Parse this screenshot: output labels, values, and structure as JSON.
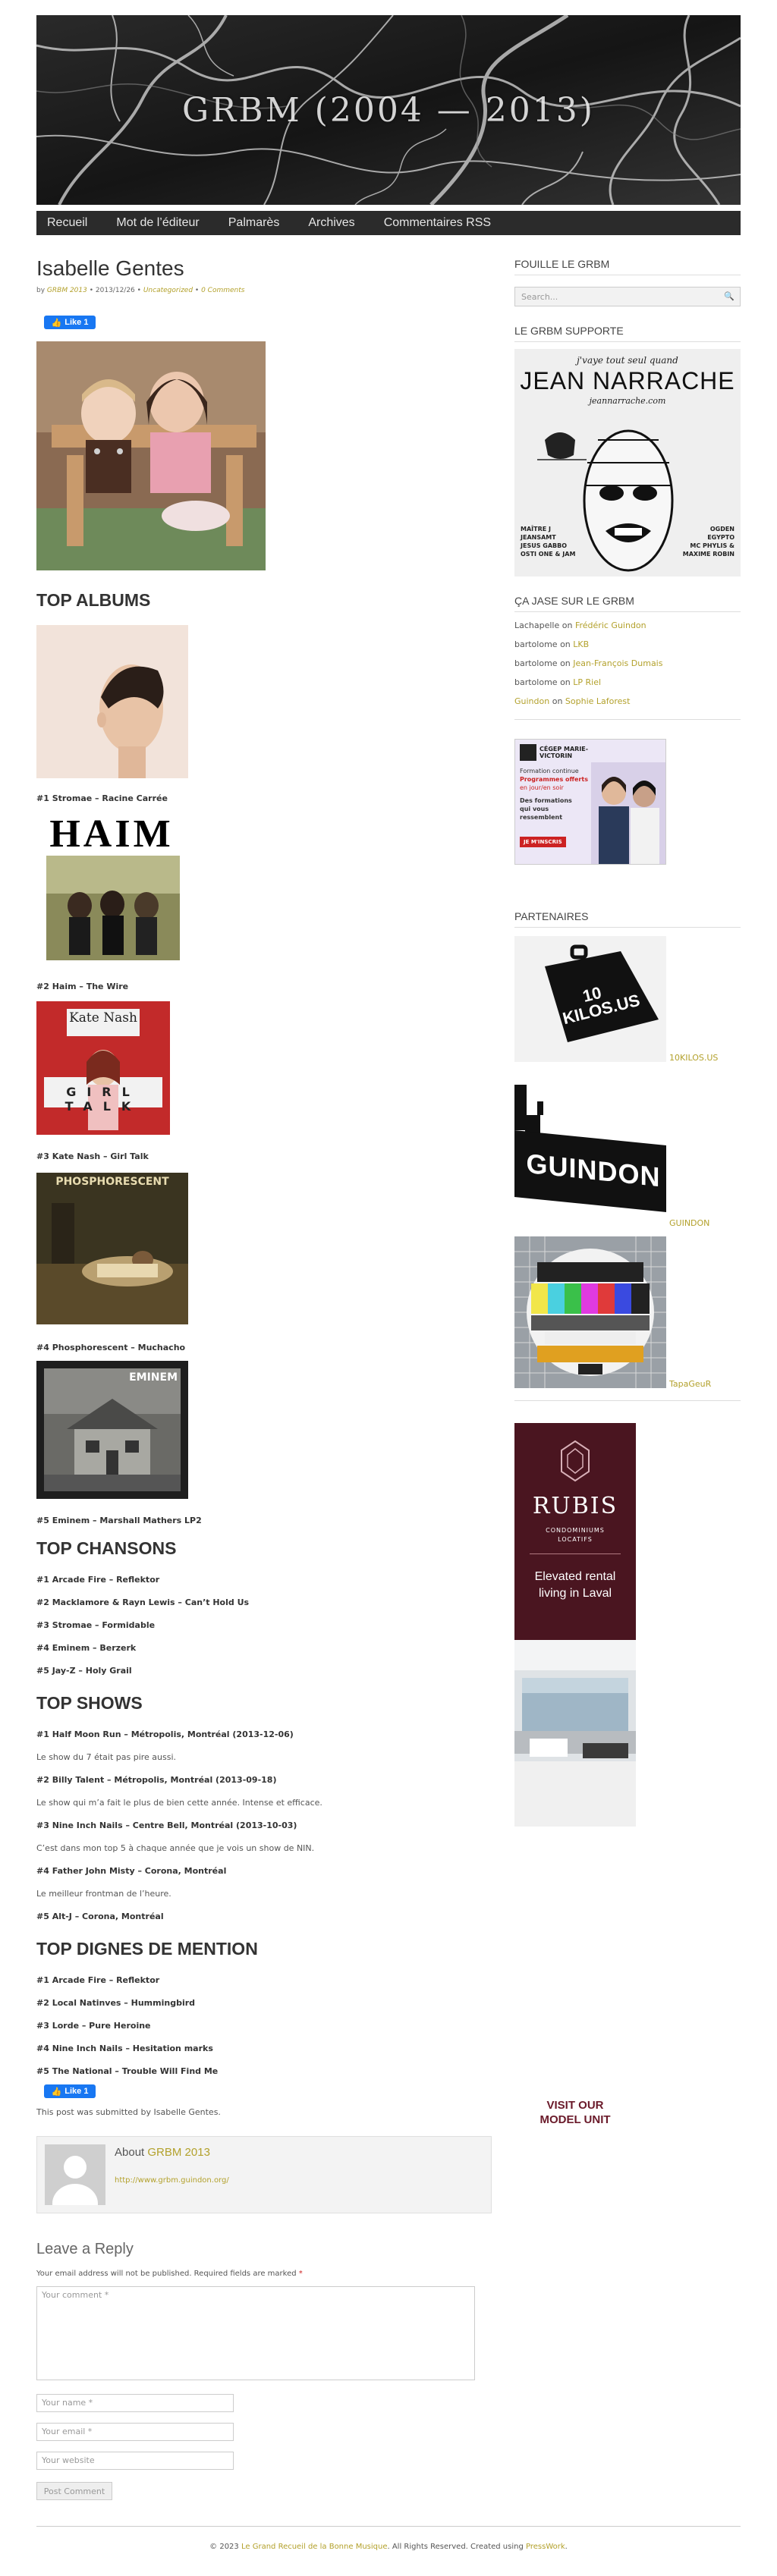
{
  "site": {
    "title": "GRBM (2004 — 2013)"
  },
  "nav": {
    "items": [
      "Recueil",
      "Mot de l’éditeur",
      "Palmarès",
      "Archives",
      "Commentaires RSS"
    ]
  },
  "post": {
    "title": "Isabelle Gentes",
    "meta_by": "by",
    "meta_author": "GRBM 2013",
    "meta_date": "2013/12/26",
    "meta_category": "Uncategorized",
    "meta_comments": "0 Comments",
    "fb_like": "Like 1",
    "sections": {
      "albums_title": "TOP ALBUMS",
      "albums": [
        "#1 Stromae – Racine Carrée",
        "#2 Haim – The Wire",
        "#3 Kate Nash – Girl Talk",
        "#4 Phosphorescent – Muchacho",
        "#5 Eminem – Marshall Mathers LP2"
      ],
      "album_art": {
        "haim": "HAIM",
        "katenash": "Kate Nash",
        "girltalk": "GIRL TALK",
        "phosphorescent": "PHOSPHORESCENT",
        "eminem": "EMINEM"
      },
      "chansons_title": "TOP CHANSONS",
      "chansons": [
        "#1 Arcade Fire – Reflektor",
        "#2 Macklamore & Rayn Lewis – Can’t Hold Us",
        "#3 Stromae – Formidable",
        "#4 Eminem – Berzerk",
        "#5 Jay-Z – Holy Grail"
      ],
      "shows_title": "TOP SHOWS",
      "shows": [
        {
          "title": "#1 Half Moon Run – Métropolis, Montréal (2013-12-06)",
          "note": "Le show du 7 était pas pire aussi."
        },
        {
          "title": "#2 Billy Talent – Métropolis, Montréal (2013-09-18)",
          "note": "Le show qui m’a fait le plus de bien cette année. Intense et efficace."
        },
        {
          "title": "#3 Nine Inch Nails – Centre Bell, Montréal (2013-10-03)",
          "note": "C’est dans mon top 5 à chaque année que je vois un show de NIN."
        },
        {
          "title": "#4 Father John Misty – Corona, Montréal",
          "note": "Le meilleur frontman de l’heure."
        },
        {
          "title": "#5 Alt-J – Corona, Montréal",
          "note": ""
        }
      ],
      "mention_title": "TOP DIGNES DE MENTION",
      "mentions": [
        "#1 Arcade Fire – Reflektor",
        "#2 Local Natinves – Hummingbird",
        "#3 Lorde – Pure Heroine",
        "#4 Nine Inch Nails – Hesitation marks",
        "#5 The National – Trouble Will Find Me"
      ],
      "submitted": "This post was submitted by Isabelle Gentes."
    },
    "about": {
      "label": "About",
      "name": "GRBM 2013",
      "url": "http://www.grbm.guindon.org/"
    }
  },
  "reply": {
    "title": "Leave a Reply",
    "notice": "Your email address will not be published. Required fields are marked",
    "required_mark": "*",
    "comment_placeholder": "Your comment *",
    "name_placeholder": "Your name *",
    "email_placeholder": "Your email *",
    "website_placeholder": "Your website",
    "submit_label": "Post Comment"
  },
  "sidebar": {
    "search_title": "FOUILLE LE GRBM",
    "search_placeholder": "Search...",
    "support_title": "LE GRBM SUPPORTE",
    "poster": {
      "line1": "j'vaye tout seul quand",
      "name": "JEAN NARRACHE",
      "site": "jeannarrache.com",
      "left_names": [
        "MAÎTRE J",
        "JEANSAMT",
        "JESUS GABBO",
        "OSTI ONE & JAM"
      ],
      "right_names": [
        "OGDEN",
        "EGYPTO",
        "MC PHYLIS &",
        "MAXIME ROBIN"
      ]
    },
    "jase_title": "ÇA JASE SUR LE GRBM",
    "comments": [
      {
        "who": "Lachapelle",
        "on": "on",
        "what": "Frédéric Guindon",
        "who_link": false
      },
      {
        "who": "bartolome",
        "on": "on",
        "what": "LKB",
        "who_link": false
      },
      {
        "who": "bartolome",
        "on": "on",
        "what": "Jean-François Dumais",
        "who_link": false
      },
      {
        "who": "bartolome",
        "on": "on",
        "what": "LP Riel",
        "who_link": false
      },
      {
        "who": "Guindon",
        "on": "on",
        "what": "Sophie Laforest",
        "who_link": true
      }
    ],
    "ad": {
      "brand": "CÉGEP MARIE-VICTORIN",
      "lines": [
        "Formation continue",
        "Programmes offerts",
        "en jour/en soir",
        "Des formations",
        "qui vous",
        "ressemblent",
        "JE M'INSCRIS"
      ]
    },
    "partners_title": "PARTENAIRES",
    "partners": [
      {
        "name": "10KILOS.US",
        "art": "10 KILOS.US"
      },
      {
        "name": "GUINDON",
        "art": "GUINDON"
      },
      {
        "name": "TapaGeuR"
      }
    ],
    "rubis": {
      "brand": "RUBIS",
      "sub": "CONDOMINIUMS LOCATIFS",
      "tag1": "Elevated rental",
      "tag2": "living in Laval",
      "cta1": "VISIT OUR",
      "cta2": "MODEL UNIT"
    }
  },
  "footer": {
    "prefix": "© 2023",
    "site_link": "Le Grand Recueil de la Bonne Musique",
    "middle": ". All Rights Reserved. Created using",
    "theme_link": "PressWork",
    "suffix": "."
  },
  "colors": {
    "accent": "#b3a12c",
    "nav_bg": "#2b2b2b",
    "fb": "#1877f2"
  }
}
